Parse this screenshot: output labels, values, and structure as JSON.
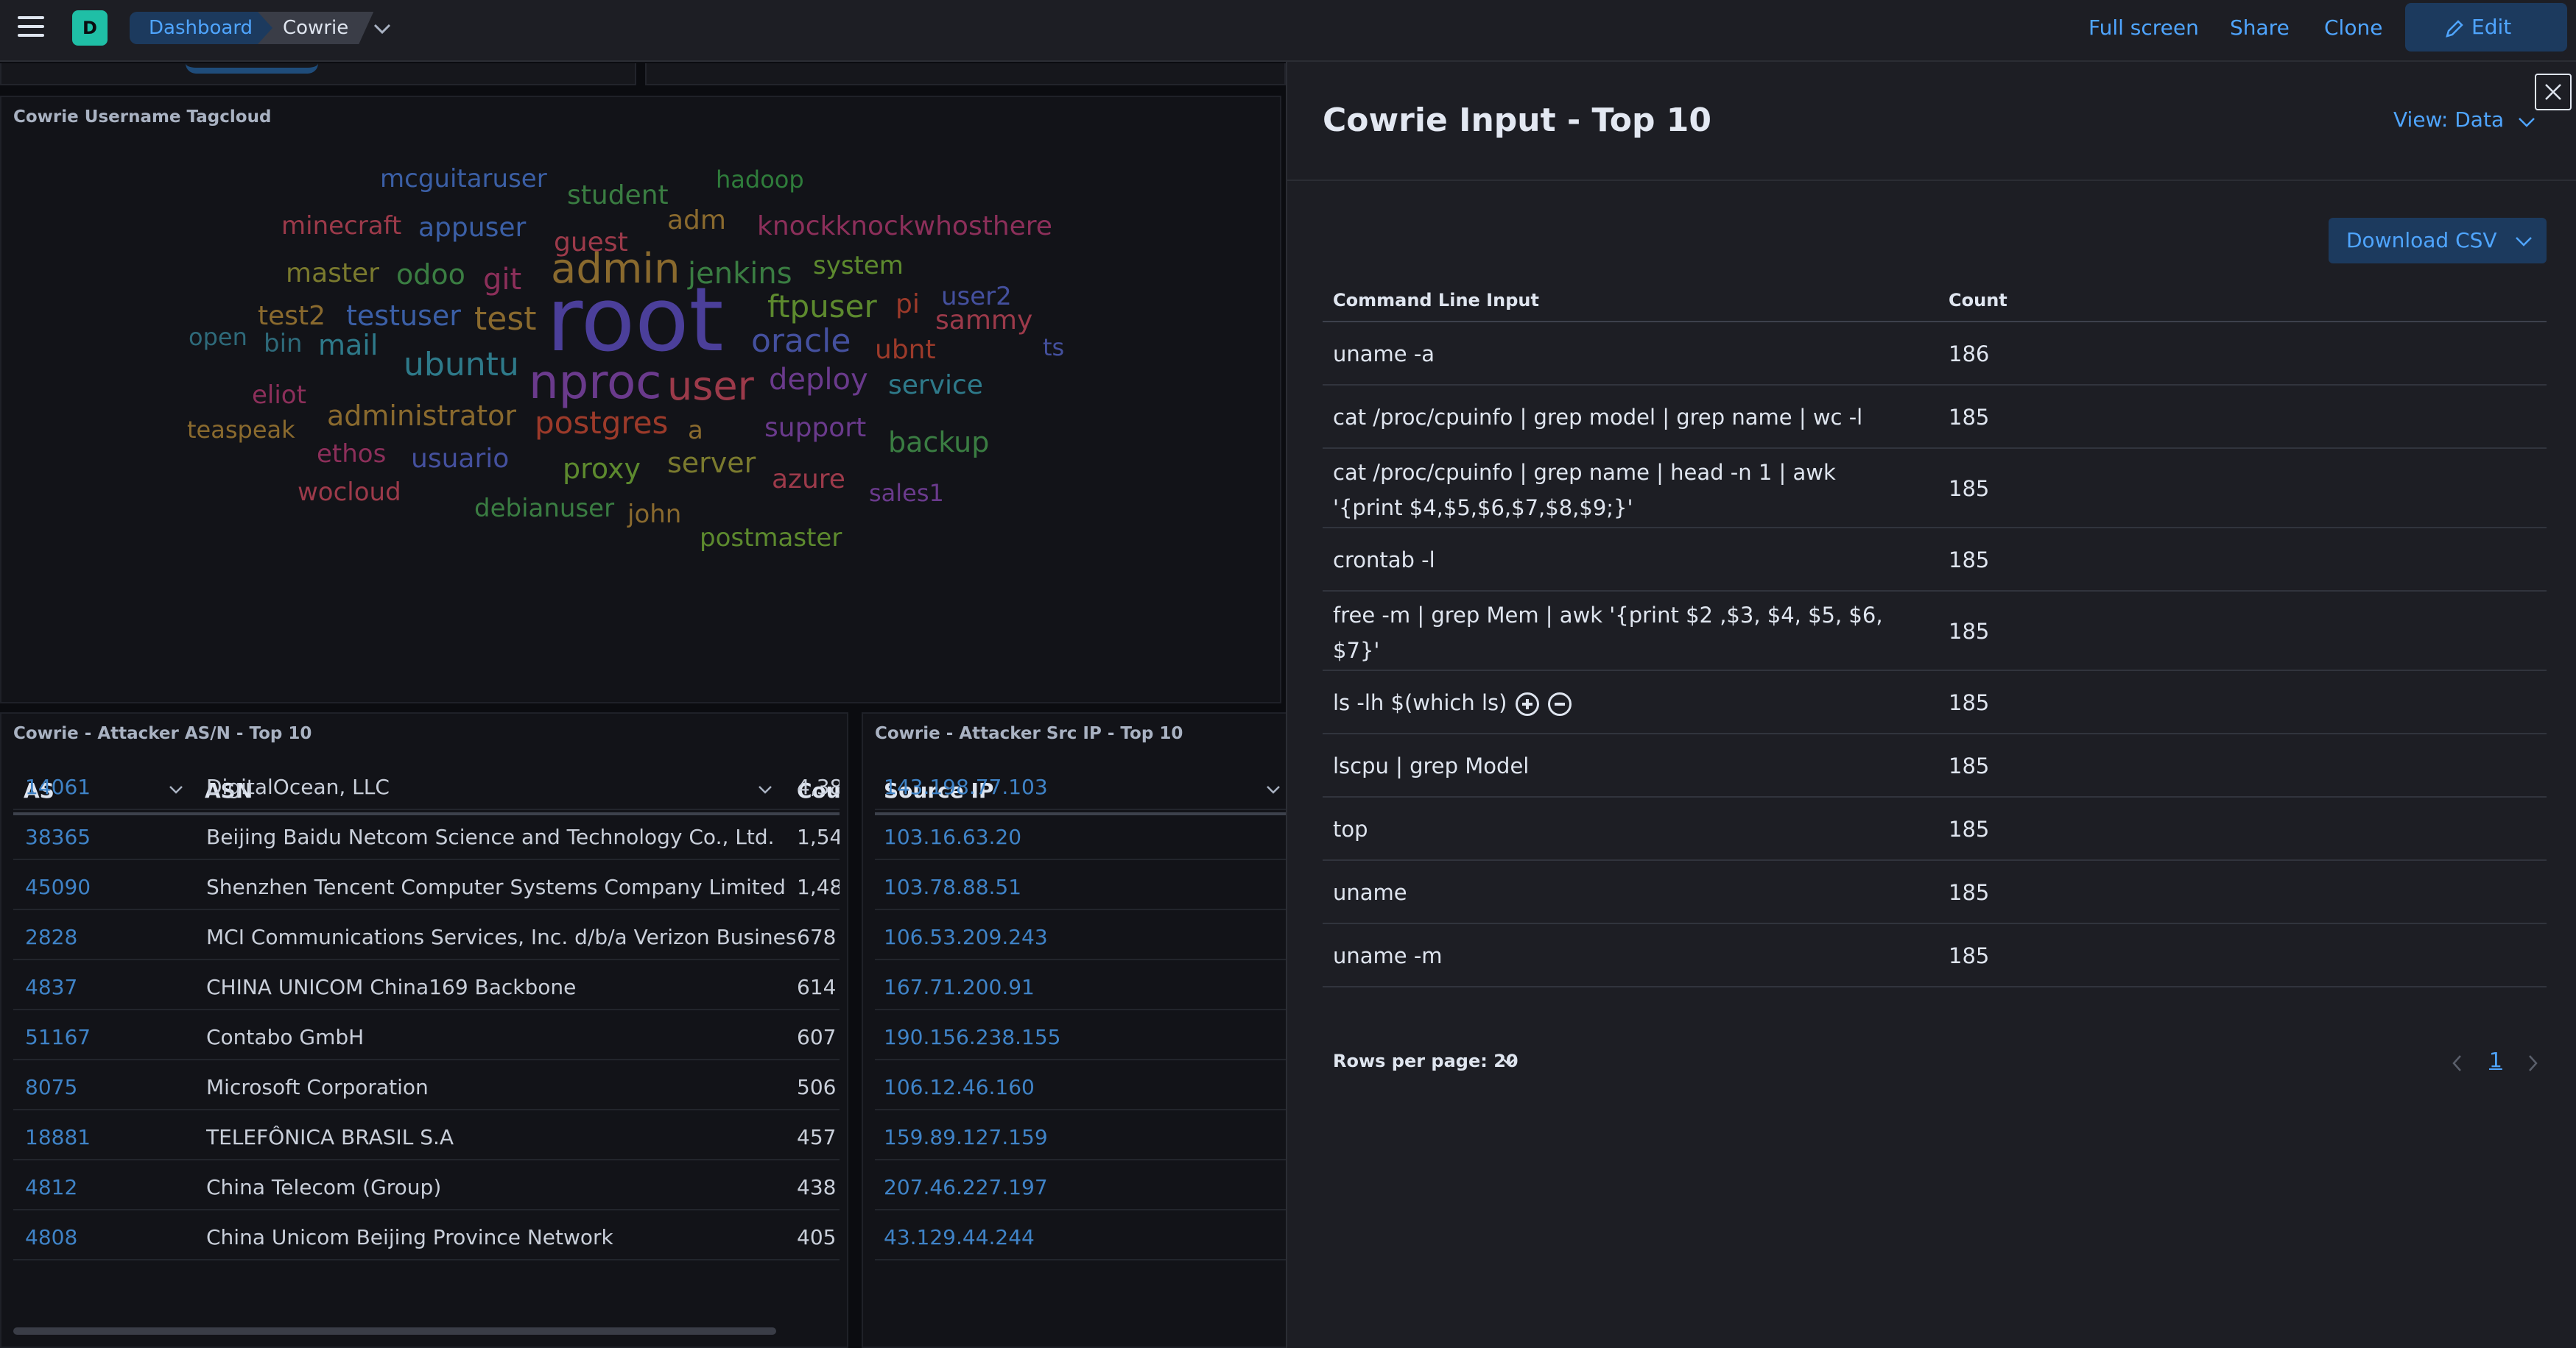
{
  "topbar": {
    "space_initial": "D",
    "breadcrumbs": [
      "Dashboard",
      "Cowrie"
    ],
    "actions": {
      "full_screen": "Full screen",
      "share": "Share",
      "clone": "Clone",
      "edit": "Edit"
    }
  },
  "tagcloud": {
    "title": "Cowrie Username Tagcloud",
    "tags": [
      {
        "text": "mcguitaruser",
        "color": "#3b5fa6"
      },
      {
        "text": "student",
        "color": "#3a7d42"
      },
      {
        "text": "hadoop",
        "color": "#2f7d3b"
      },
      {
        "text": "minecraft",
        "color": "#9c3a4a"
      },
      {
        "text": "appuser",
        "color": "#3b5fa6"
      },
      {
        "text": "guest",
        "color": "#9c3a4a"
      },
      {
        "text": "adm",
        "color": "#8a6a2e"
      },
      {
        "text": "knockknockwhosthere",
        "color": "#8c2f5a"
      },
      {
        "text": "jenkins",
        "color": "#3a7d42"
      },
      {
        "text": "system",
        "color": "#5d8a2e"
      },
      {
        "text": "master",
        "color": "#7a7a2e"
      },
      {
        "text": "odoo",
        "color": "#3a7d42"
      },
      {
        "text": "git",
        "color": "#8c2f5a"
      },
      {
        "text": "admin",
        "color": "#8a6a2e"
      },
      {
        "text": "ftpuser",
        "color": "#5d8a2e"
      },
      {
        "text": "pi",
        "color": "#9c3a2a"
      },
      {
        "text": "user2",
        "color": "#44509e"
      },
      {
        "text": "test2",
        "color": "#8a6a2e"
      },
      {
        "text": "testuser",
        "color": "#3b5fa6"
      },
      {
        "text": "test",
        "color": "#8a6a2e"
      },
      {
        "text": "sammy",
        "color": "#9c3a4a"
      },
      {
        "text": "root",
        "color": "#4b3f9a"
      },
      {
        "text": "open",
        "color": "#2e6a7a"
      },
      {
        "text": "bin",
        "color": "#2e6a7a"
      },
      {
        "text": "mail",
        "color": "#2e7a8a"
      },
      {
        "text": "oracle",
        "color": "#44509e"
      },
      {
        "text": "ubnt",
        "color": "#9c3a2a"
      },
      {
        "text": "ts",
        "color": "#44509e"
      },
      {
        "text": "ubuntu",
        "color": "#2e7a8a"
      },
      {
        "text": "nproc",
        "color": "#6a3a8c"
      },
      {
        "text": "user",
        "color": "#9c3a4a"
      },
      {
        "text": "deploy",
        "color": "#6a3a8c"
      },
      {
        "text": "service",
        "color": "#2e7a8a"
      },
      {
        "text": "eliot",
        "color": "#8c2f5a"
      },
      {
        "text": "administrator",
        "color": "#8a6a2e"
      },
      {
        "text": "teaspeak",
        "color": "#8a6a2e"
      },
      {
        "text": "postgres",
        "color": "#9c3a2a"
      },
      {
        "text": "a",
        "color": "#8a6a2e"
      },
      {
        "text": "support",
        "color": "#6a3a8c"
      },
      {
        "text": "backup",
        "color": "#3a7d42"
      },
      {
        "text": "ethos",
        "color": "#8c2f5a"
      },
      {
        "text": "usuario",
        "color": "#44509e"
      },
      {
        "text": "proxy",
        "color": "#5d8a2e"
      },
      {
        "text": "server",
        "color": "#7a7a2e"
      },
      {
        "text": "azure",
        "color": "#9c3a4a"
      },
      {
        "text": "wocloud",
        "color": "#9c3a4a"
      },
      {
        "text": "sales1",
        "color": "#6a3a8c"
      },
      {
        "text": "debianuser",
        "color": "#3a7d42"
      },
      {
        "text": "john",
        "color": "#8a6a2e"
      },
      {
        "text": "postmaster",
        "color": "#5d8a2e"
      }
    ]
  },
  "asn_table": {
    "title": "Cowrie - Attacker AS/N - Top 10",
    "columns": [
      "AS",
      "ASN",
      "Cou"
    ],
    "rows": [
      [
        "14061",
        "DigitalOcean, LLC",
        "4,38"
      ],
      [
        "38365",
        "Beijing Baidu Netcom Science and Technology Co., Ltd.",
        "1,54"
      ],
      [
        "45090",
        "Shenzhen Tencent Computer Systems Company Limited",
        "1,48"
      ],
      [
        "2828",
        "MCI Communications Services, Inc. d/b/a Verizon Business",
        "678"
      ],
      [
        "4837",
        "CHINA UNICOM China169 Backbone",
        "614"
      ],
      [
        "51167",
        "Contabo GmbH",
        "607"
      ],
      [
        "8075",
        "Microsoft Corporation",
        "506"
      ],
      [
        "18881",
        "TELEFÔNICA BRASIL S.A",
        "457"
      ],
      [
        "4812",
        "China Telecom (Group)",
        "438"
      ],
      [
        "4808",
        "China Unicom Beijing Province Network",
        "405"
      ]
    ]
  },
  "ip_table": {
    "title": "Cowrie - Attacker Src IP - Top 10",
    "columns": [
      "Source IP"
    ],
    "rows": [
      "143.198.77.103",
      "103.16.63.20",
      "103.78.88.51",
      "106.53.209.243",
      "167.71.200.91",
      "190.156.238.155",
      "106.12.46.160",
      "159.89.127.159",
      "207.46.227.197",
      "43.129.44.244"
    ]
  },
  "flyout": {
    "title": "Cowrie Input - Top 10",
    "view": "View: Data",
    "download": "Download CSV",
    "columns": [
      "Command Line Input",
      "Count"
    ],
    "rows": [
      {
        "input": "uname -a",
        "count": "186"
      },
      {
        "input": "cat /proc/cpuinfo | grep model | grep name | wc -l",
        "count": "185"
      },
      {
        "input": "cat /proc/cpuinfo | grep name | head -n 1 | awk '{print $4,$5,$6,$7,$8,$9;}'",
        "count": "185"
      },
      {
        "input": "crontab -l",
        "count": "185"
      },
      {
        "input": "free -m | grep Mem | awk '{print $2 ,$3, $4, $5, $6, $7}'",
        "count": "185"
      },
      {
        "input": "ls -lh $(which ls)",
        "count": "185"
      },
      {
        "input": "lscpu | grep Model",
        "count": "185"
      },
      {
        "input": "top",
        "count": "185"
      },
      {
        "input": "uname",
        "count": "185"
      },
      {
        "input": "uname -m",
        "count": "185"
      }
    ],
    "rows_per_page": "Rows per page: 20",
    "current_page": "1"
  }
}
